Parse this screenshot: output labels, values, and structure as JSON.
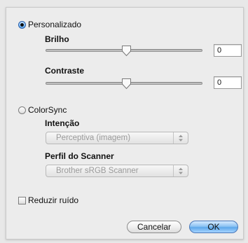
{
  "modes": {
    "personalizado_label": "Personalizado",
    "personalizado_selected": true,
    "colorsync_label": "ColorSync",
    "colorsync_selected": false
  },
  "brilho": {
    "label": "Brilho",
    "value": "0",
    "slider_fraction": 0.5
  },
  "contraste": {
    "label": "Contraste",
    "value": "0",
    "slider_fraction": 0.5
  },
  "colorsync": {
    "intencao_label": "Intenção",
    "intencao_value": "Perceptiva (imagem)",
    "perfil_label": "Perfil do Scanner",
    "perfil_value": "Brother sRGB Scanner"
  },
  "reduzir_ruido": {
    "label": "Reduzir ruído",
    "checked": false
  },
  "buttons": {
    "cancel": "Cancelar",
    "ok": "OK"
  },
  "icons": {
    "radio": "radio-button-icon",
    "slider_thumb": "slider-thumb-icon",
    "popup_arrows": "up-down-arrows-icon"
  }
}
